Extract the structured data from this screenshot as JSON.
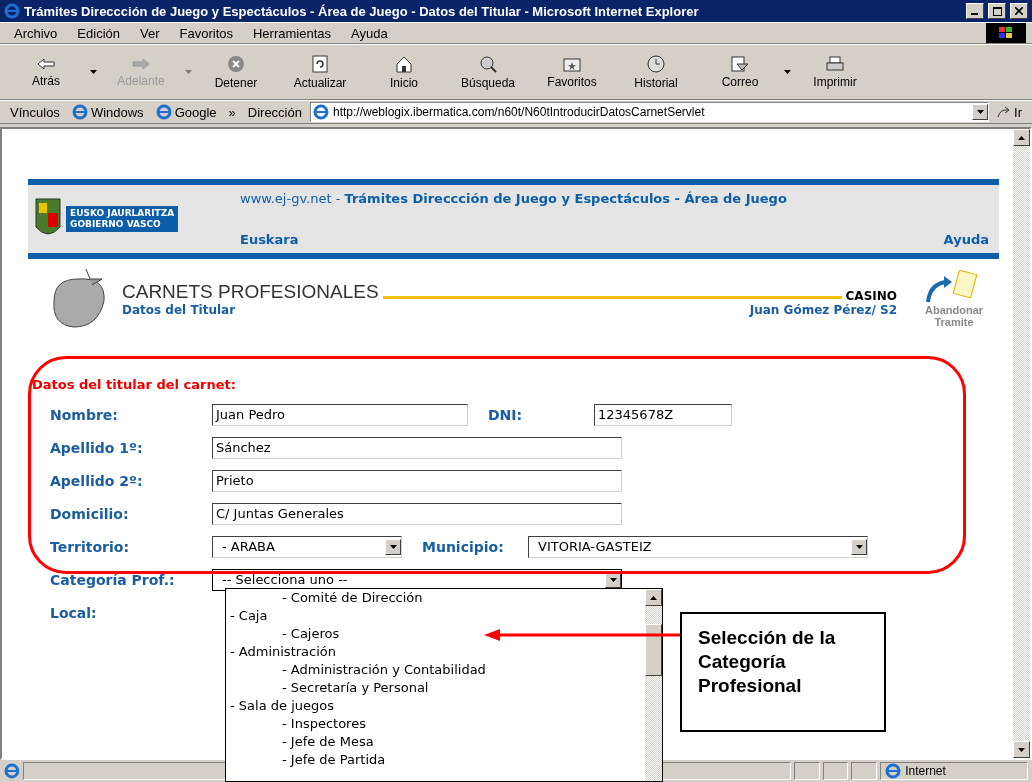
{
  "window": {
    "title": "Trámites Direccción de Juego y Espectáculos - Área de Juego - Datos del Titular - Microsoft Internet Explorer"
  },
  "menu": [
    "Archivo",
    "Edición",
    "Ver",
    "Favoritos",
    "Herramientas",
    "Ayuda"
  ],
  "toolbar": [
    {
      "label": "Atrás",
      "kind": "nav",
      "disabled": false,
      "caret": true
    },
    {
      "label": "Adelante",
      "kind": "nav",
      "disabled": true,
      "caret": true
    },
    {
      "label": "Detener",
      "kind": "stop",
      "disabled": false,
      "caret": false
    },
    {
      "label": "Actualizar",
      "kind": "refresh",
      "disabled": false,
      "caret": false
    },
    {
      "label": "Inicio",
      "kind": "home",
      "disabled": false,
      "caret": false
    },
    {
      "label": "Búsqueda",
      "kind": "search",
      "disabled": false,
      "caret": false
    },
    {
      "label": "Favoritos",
      "kind": "favorites",
      "disabled": false,
      "caret": false
    },
    {
      "label": "Historial",
      "kind": "history",
      "disabled": false,
      "caret": false
    },
    {
      "label": "Correo",
      "kind": "mail",
      "disabled": false,
      "caret": true
    },
    {
      "label": "Imprimir",
      "kind": "print",
      "disabled": false,
      "caret": false
    }
  ],
  "links": {
    "label": "Vínculos",
    "items": [
      "Windows",
      "Google"
    ],
    "more": "»"
  },
  "address": {
    "label": "Dirección",
    "url": "http://weblogix.ibermatica.com/n60t/N60tIntroducirDatosCarnetServlet",
    "go": "Ir"
  },
  "header": {
    "logo_lines": [
      "EUSKO JAURLARITZA",
      "GOBIERNO VASCO"
    ],
    "title": "www.ej-gv.net - **Trámites Direccción de Juego y Espectáculos - Área de Juego**",
    "language": "Euskara",
    "help": "Ayuda"
  },
  "section": {
    "title": "CARNETS PROFESIONALES",
    "subtitle": "Datos del Titular",
    "area": "CASINO",
    "user": "Juan Gómez Pérez/ S2",
    "abandon": "Abandonar Tramite"
  },
  "form": {
    "heading": "Datos del titular del carnet:",
    "rows": [
      [
        {
          "label": "Nombre:",
          "kind": "text",
          "value": "Juan Pedro"
        },
        {
          "label": "DNI:",
          "kind": "text",
          "value": "12345678Z"
        }
      ],
      [
        {
          "label": "Apellido 1º:",
          "kind": "text",
          "value": "Sánchez"
        }
      ],
      [
        {
          "label": "Apellido 2º:",
          "kind": "text",
          "value": "Prieto"
        }
      ],
      [
        {
          "label": "Domicilio:",
          "kind": "text",
          "value": "C/ Juntas Generales"
        }
      ],
      [
        {
          "label": "Territorio:",
          "kind": "select",
          "value": "- ARABA",
          "expanded": false
        },
        {
          "label": "Municipio:",
          "kind": "select",
          "value": "VITORIA-GASTEIZ",
          "expanded": false
        }
      ],
      [
        {
          "label": "Categoría Prof.:",
          "kind": "select",
          "value": "-- Selecciona uno --",
          "expanded": true
        }
      ],
      [
        {
          "label": "Local:"
        }
      ]
    ]
  },
  "options": [
    {
      "children": [
        {
          "label": "- Comité de Dirección",
          "selected": false
        }
      ]
    },
    {
      "label": "- Caja",
      "selected": false,
      "children": [
        {
          "label": "- Cajeros",
          "selected": false
        }
      ]
    },
    {
      "label": "- Administración",
      "selected": false,
      "children": [
        {
          "label": "- Administración y Contabilidad",
          "selected": false
        },
        {
          "label": "- Secretaría y Personal",
          "selected": false
        }
      ]
    },
    {
      "label": "- Sala de juegos",
      "selected": false,
      "children": [
        {
          "label": "- Inspectores",
          "selected": false
        },
        {
          "label": "- Jefe de Mesa",
          "selected": false
        },
        {
          "label": "- Jefe de Partida",
          "selected": false
        }
      ]
    }
  ],
  "callout": {
    "text": "Selección de la Categoría Profesional"
  },
  "status_bar": {
    "zone": "Internet"
  }
}
